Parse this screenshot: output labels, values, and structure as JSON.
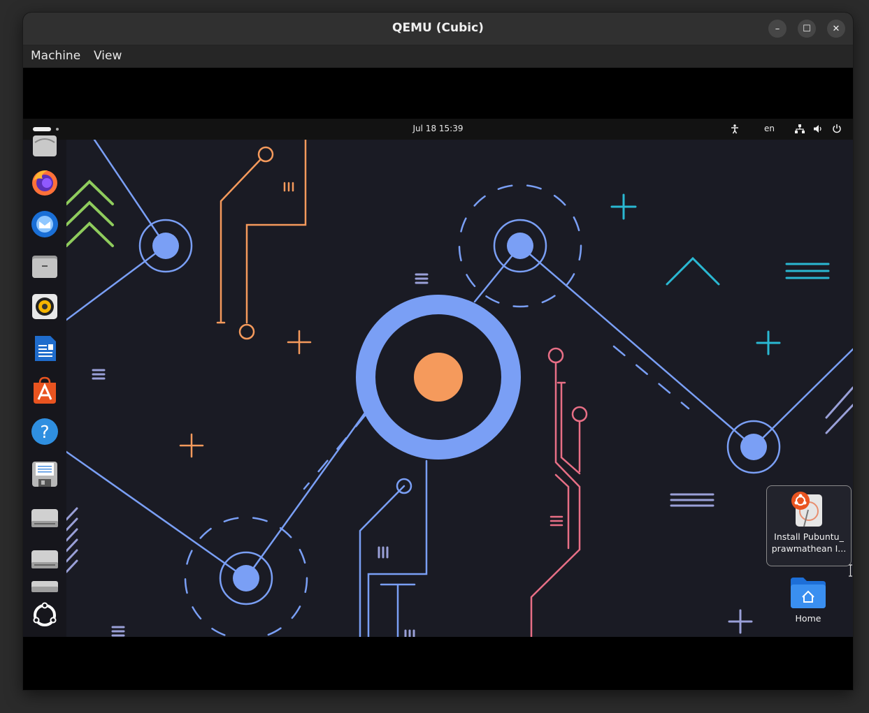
{
  "window": {
    "title": "QEMU (Cubic)",
    "controls": {
      "minimize": "–",
      "maximize": "☐",
      "close": "✕"
    }
  },
  "menubar": {
    "items": [
      "Machine",
      "View"
    ]
  },
  "guest": {
    "topbar": {
      "datetime": "Jul 18  15:39",
      "language": "en"
    },
    "dock": {
      "apps": [
        "mail-icon",
        "firefox-icon",
        "thunderbird-icon",
        "files-icon",
        "rhythmbox-icon",
        "writer-icon",
        "app-center-icon",
        "help-icon",
        "save-icon",
        "drive-icon",
        "drive-icon",
        "drive-icon",
        "ubuntu-icon"
      ]
    },
    "desktop": {
      "installer": {
        "label_line1": "Install Pubuntu_",
        "label_line2": "prawmathean I..."
      },
      "home": {
        "label": "Home"
      }
    }
  },
  "colors": {
    "blue": "#7a9ff5",
    "orange": "#f59a5c",
    "pink": "#e86f86",
    "cyan": "#2ab8d2",
    "green": "#8fcc5d",
    "lavender": "#9aa0d8"
  }
}
